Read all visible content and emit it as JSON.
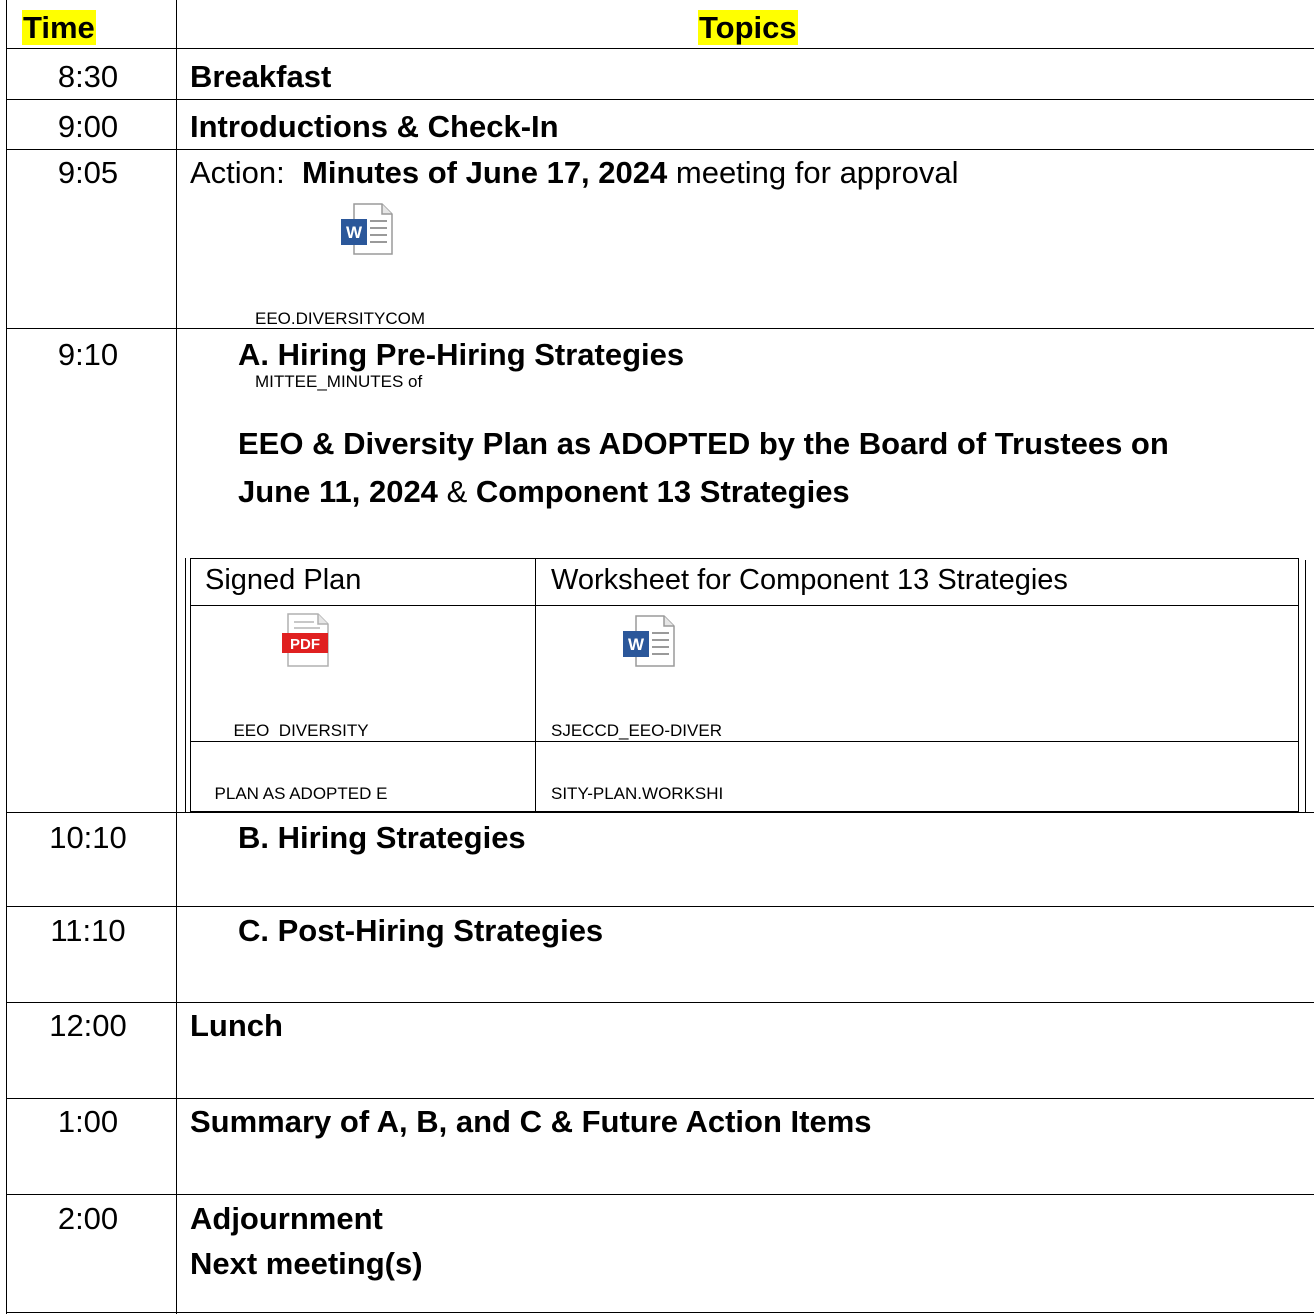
{
  "header": {
    "time_label": "Time",
    "topics_label": "Topics"
  },
  "rows": [
    {
      "time": "8:30",
      "topic": "Breakfast"
    },
    {
      "time": "9:00",
      "topic": "Introductions & Check-In"
    },
    {
      "time": "9:05",
      "action_prefix": "Action:",
      "action_bold": "Minutes of June 17, 2024",
      "action_suffix": "meeting for approval",
      "attachment": {
        "icon": "word-document-icon",
        "caption_line1": "EEO.DIVERSITYCOM",
        "caption_line2": "MITTEE_MINUTES of"
      }
    },
    {
      "time": "9:10",
      "heading": "A.  Hiring Pre-Hiring Strategies",
      "plan_line1": "EEO & Diversity Plan as ADOPTED by the Board of Trustees on",
      "plan_line2_bold_a": "June 11, 2024",
      "plan_line2_amp": "&",
      "plan_line2_bold_b": "Component 13 Strategies",
      "inner_table": {
        "col1_header": "Signed Plan",
        "col2_header": "Worksheet for Component 13 Strategies",
        "col1_file": {
          "icon": "pdf-document-icon",
          "pdf_label": "PDF",
          "caption_line1": "EEO  DIVERSITY",
          "caption_line2": "PLAN AS ADOPTED E"
        },
        "col2_file": {
          "icon": "word-document-icon",
          "caption_line1": "SJECCD_EEO-DIVER",
          "caption_line2": "SITY-PLAN.WORKSHI"
        }
      }
    },
    {
      "time": "10:10",
      "topic": "B.  Hiring Strategies"
    },
    {
      "time": "11:10",
      "topic": "C.  Post-Hiring Strategies"
    },
    {
      "time": "12:00",
      "topic": "Lunch"
    },
    {
      "time": "1:00",
      "topic": "Summary of A, B, and C & Future Action Items"
    },
    {
      "time": "2:00",
      "topic_line1": "Adjournment",
      "topic_line2": "Next meeting(s)"
    }
  ],
  "colors": {
    "highlight": "#ffff00",
    "word_blue": "#2b579a",
    "pdf_red": "#e02020"
  }
}
